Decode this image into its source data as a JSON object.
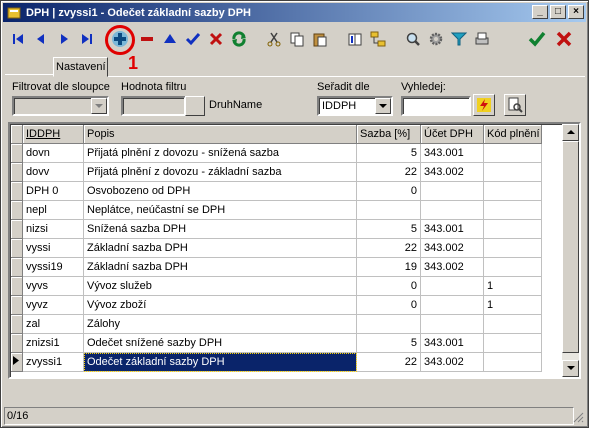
{
  "window": {
    "title": "DPH | zvyssi1 - Odečet základní sazby DPH"
  },
  "annotation": {
    "number": "1"
  },
  "toolbar": {
    "buttons": [
      "first-icon",
      "prior-icon",
      "next-icon",
      "last-icon",
      "add-icon",
      "delete-icon",
      "edit-icon",
      "post-icon",
      "cancel-icon",
      "refresh-icon",
      "cut-icon",
      "copy-icon",
      "paste-icon",
      "book-icon",
      "tree-icon",
      "search-icon",
      "gear-icon",
      "filter-icon",
      "print-icon",
      "ok-icon",
      "close-icon"
    ]
  },
  "tabs": {
    "settings": "Nastavení"
  },
  "filter": {
    "column_label": "Filtrovat dle sloupce",
    "column_value": "",
    "value_label": "Hodnota filtru",
    "value_value": "",
    "field_name": "DruhName",
    "sort_label": "Seřadit dle",
    "sort_value": "IDDPH",
    "search_label": "Vyhledej:",
    "search_value": ""
  },
  "colors": {
    "selection": "#0a246a",
    "title_start": "#0a246a",
    "title_end": "#a6caf0",
    "annotation": "#e00000"
  },
  "grid": {
    "columns": [
      "IDDPH",
      "Popis",
      "Sazba [%]",
      "Účet DPH",
      "Kód plnění"
    ],
    "rows": [
      [
        "dovn",
        "Přijatá plnění z dovozu - snížená sazba",
        "5",
        "343.001",
        ""
      ],
      [
        "dovv",
        "Přijatá plnění z dovozu - základní sazba",
        "22",
        "343.002",
        ""
      ],
      [
        "DPH 0",
        "Osvobozeno od DPH",
        "0",
        "",
        ""
      ],
      [
        "nepl",
        "Neplátce, neúčastní se DPH",
        "",
        "",
        ""
      ],
      [
        "nizsi",
        "Snížená sazba DPH",
        "5",
        "343.001",
        ""
      ],
      [
        "vyssi",
        "Základní sazba DPH",
        "22",
        "343.002",
        ""
      ],
      [
        "vyssi19",
        "Základní sazba DPH",
        "19",
        "343.002",
        ""
      ],
      [
        "vyvs",
        "Vývoz služeb",
        "0",
        "",
        "1"
      ],
      [
        "vyvz",
        "Vývoz zboží",
        "0",
        "",
        "1"
      ],
      [
        "zal",
        "Zálohy",
        "",
        "",
        ""
      ],
      [
        "znizsi1",
        "Odečet snížené sazby DPH",
        "5",
        "343.001",
        ""
      ],
      [
        "zvyssi1",
        "Odečet základní sazby DPH",
        "22",
        "343.002",
        ""
      ]
    ],
    "selected_row": 11
  },
  "status": {
    "record": "0/16"
  }
}
